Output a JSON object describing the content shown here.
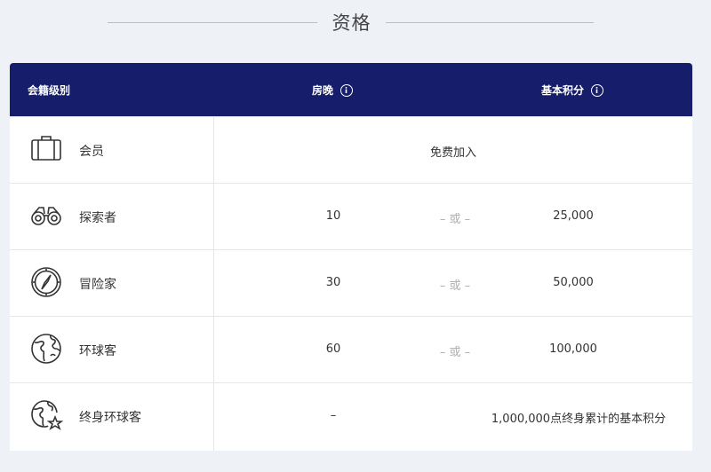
{
  "section": {
    "title": "资格"
  },
  "table": {
    "headers": {
      "level": "会籍级别",
      "nights": "房晚",
      "points": "基本积分"
    },
    "or_text": "或",
    "rows": [
      {
        "icon": "suitcase-icon",
        "name": "会员",
        "span_text": "免费加入"
      },
      {
        "icon": "binoculars-icon",
        "name": "探索者",
        "nights": "10",
        "points": "25,000"
      },
      {
        "icon": "compass-icon",
        "name": "冒险家",
        "nights": "30",
        "points": "50,000"
      },
      {
        "icon": "globe-icon",
        "name": "环球客",
        "nights": "60",
        "points": "100,000"
      },
      {
        "icon": "globe-star-icon",
        "name": "终身环球客",
        "nights": "–",
        "points": "1,000,000点终身累计的基本积分"
      }
    ]
  },
  "colors": {
    "header_bg": "#161e6b",
    "page_bg": "#eef2f7",
    "or_color": "#b0b0b0"
  }
}
